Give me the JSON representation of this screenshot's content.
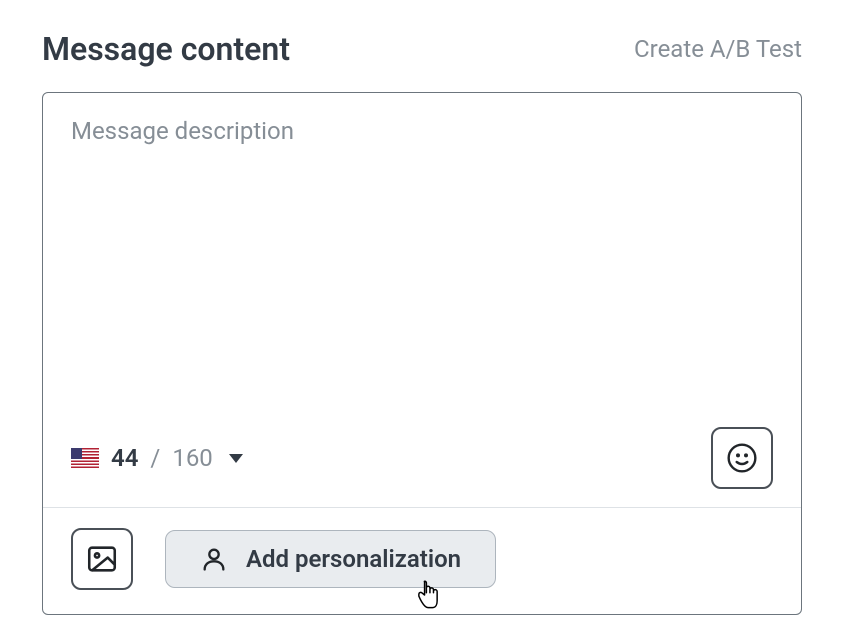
{
  "header": {
    "title": "Message content",
    "ab_test_label": "Create A/B Test"
  },
  "editor": {
    "placeholder": "Message description",
    "value": ""
  },
  "counter": {
    "flag": "us",
    "current": "44",
    "separator": "/",
    "max": "160"
  },
  "buttons": {
    "emoji": "Insert emoji",
    "image": "Insert image",
    "personalization": "Add personalization"
  }
}
